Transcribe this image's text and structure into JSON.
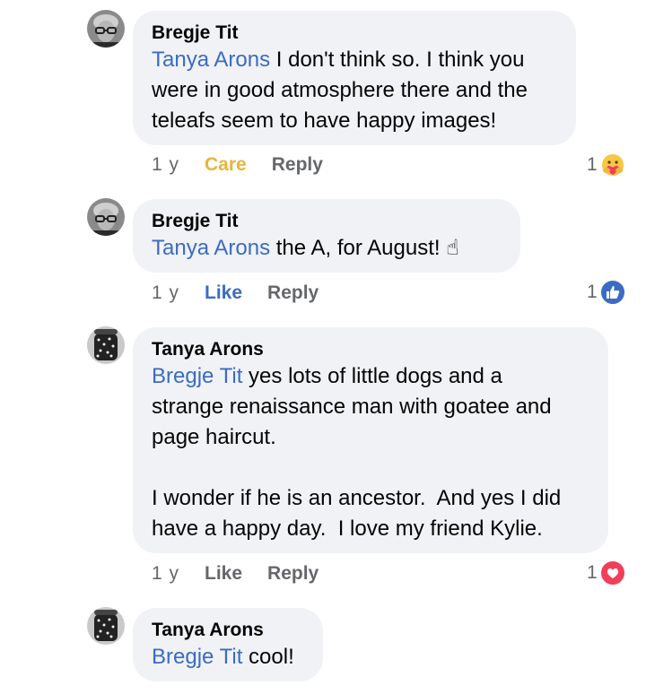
{
  "comments": [
    {
      "author": "Bregje Tit",
      "mention": "Tanya Arons",
      "text": " I don't think so. I think you\nwere in good atmosphere there and the\nteleafs seem to have happy images!",
      "time": "1 y",
      "reaction_label": "Care",
      "reply_label": "Reply",
      "reaction_count": "1",
      "reaction_icon": "care-emoji-icon",
      "reaction_color": "#e7b53b"
    },
    {
      "author": "Bregje Tit",
      "mention": "Tanya Arons",
      "text": " the A, for August! ☝",
      "time": "1 y",
      "reaction_label": "Like",
      "reply_label": "Reply",
      "reaction_count": "1",
      "reaction_icon": "like-icon",
      "reaction_color": "#3b6bc4"
    },
    {
      "author": "Tanya Arons",
      "mention": "Bregje Tit",
      "text": " yes lots of little dogs and a\nstrange renaissance man with goatee and\npage haircut.\n\nI wonder if he is an ancestor.  And yes I did\nhave a happy day.  I love my friend Kylie.",
      "time": "1 y",
      "reaction_label": "Like",
      "reply_label": "Reply",
      "reaction_count": "1",
      "reaction_icon": "love-icon",
      "reaction_color": "#f33e58"
    },
    {
      "author": "Tanya Arons",
      "mention": "Bregje Tit",
      "text": " cool!"
    }
  ]
}
